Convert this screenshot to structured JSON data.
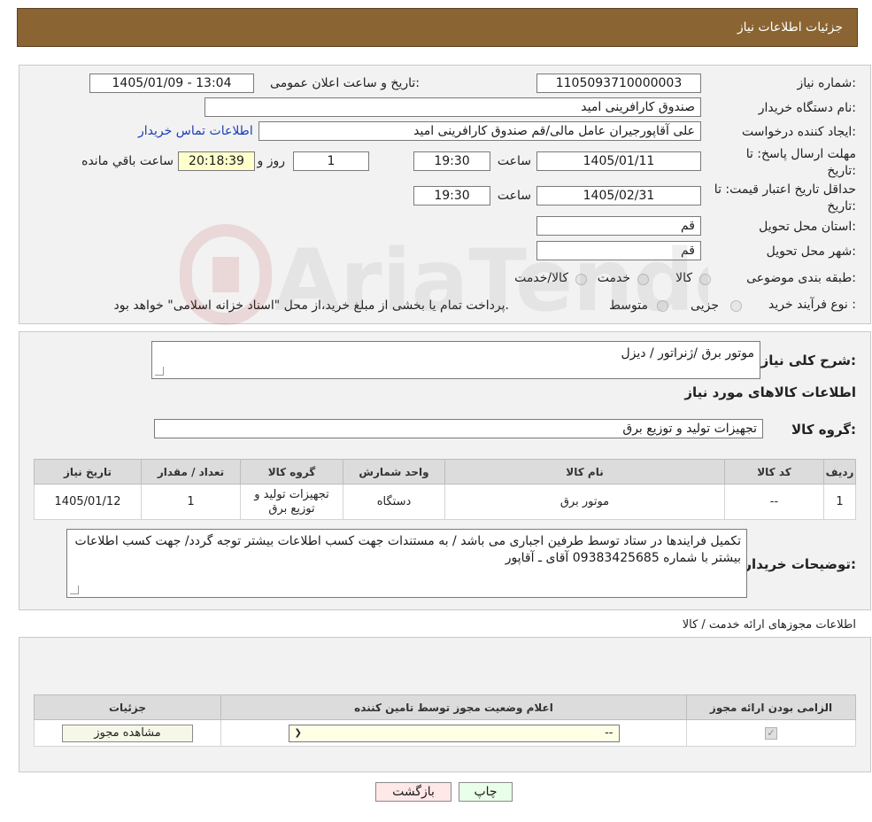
{
  "header": {
    "title": "جزئیات اطلاعات نیاز"
  },
  "form": {
    "need_number_label": "شماره نیاز:",
    "need_number": "1105093710000003",
    "announce_label": "تاریخ و ساعت اعلان عمومی:",
    "announce_value": "1405/01/09 - 13:04",
    "buyer_org_label": "نام دستگاه خریدار:",
    "buyer_org": "صندوق کارافرینی امید",
    "creator_label": "ایجاد کننده درخواست:",
    "creator": "علی آقاپورجیران عامل مالی/قم صندوق کارافرینی امید",
    "contact_link": "اطلاعات تماس خریدار",
    "deadline_label": "مهلت ارسال پاسخ: تا تاریخ:",
    "deadline_date": "1405/01/11",
    "time_label": "ساعت",
    "deadline_time": "19:30",
    "days_value": "1",
    "days_label": "روز و",
    "remaining_time": "20:18:39",
    "remaining_label": "ساعت باقي مانده",
    "validity_label": "حداقل تاریخ اعتبار قیمت: تا تاریخ:",
    "validity_date": "1405/02/31",
    "validity_time": "19:30",
    "province_label": "استان محل تحویل:",
    "province": "قم",
    "city_label": "شهر محل تحویل:",
    "city": "قم",
    "category_label": "طبقه بندی موضوعی:",
    "category_options": [
      "کالا",
      "خدمت",
      "کالا/خدمت"
    ],
    "process_label": "نوع فرآیند خرید :",
    "process_options": [
      "جزیی",
      "متوسط"
    ],
    "process_note": "پرداخت تمام یا بخشی از مبلغ خرید،از محل \"اسناد خزانه اسلامی\" خواهد بود."
  },
  "details": {
    "summary_label": "شرح کلی نیاز:",
    "summary_value": "موتور برق /ژنراتور / دیزل",
    "goods_title": "اطلاعات کالاهای مورد نیاز",
    "group_label": "گروه کالا:",
    "group_value": "تجهیزات تولید و توزیع برق",
    "table": {
      "headers": [
        "ردیف",
        "کد کالا",
        "نام کالا",
        "واحد شمارش",
        "گروه کالا",
        "تعداد / مقدار",
        "تاریخ نیاز"
      ],
      "rows": [
        [
          "1",
          "--",
          "موتور برق",
          "دستگاه",
          "تجهیزات تولید و توزیع برق",
          "1",
          "1405/01/12"
        ]
      ]
    },
    "buyer_notes_label": "توضیحات خریدار:",
    "buyer_notes": "تکمیل فرایندها در ستاد توسط طرفین اجباری می باشد / به مستندات جهت کسب اطلاعات بیشتر توجه گردد/ جهت کسب اطلاعات بیشتر با شماره  09383425685 آقای ـ آقاپور"
  },
  "licenses": {
    "title": "اطلاعات مجوزهای ارائه خدمت / کالا",
    "headers": [
      "الزامی بودن ارائه مجوز",
      "اعلام وضعیت مجوز توسط تامین کننده",
      "جزئیات"
    ],
    "select_value": "--",
    "view_button": "مشاهده مجوز"
  },
  "footer": {
    "print_button": "چاپ",
    "back_button": "بازگشت"
  },
  "watermark": {
    "text": "AriaTender.neT"
  },
  "colors": {
    "header_bg": "#8a6432",
    "panel_bg": "#f2f2f2",
    "link": "#1a3db8",
    "time_bg": "#ffffcc",
    "print_bg": "#eaffea",
    "back_bg": "#ffe8e8"
  }
}
